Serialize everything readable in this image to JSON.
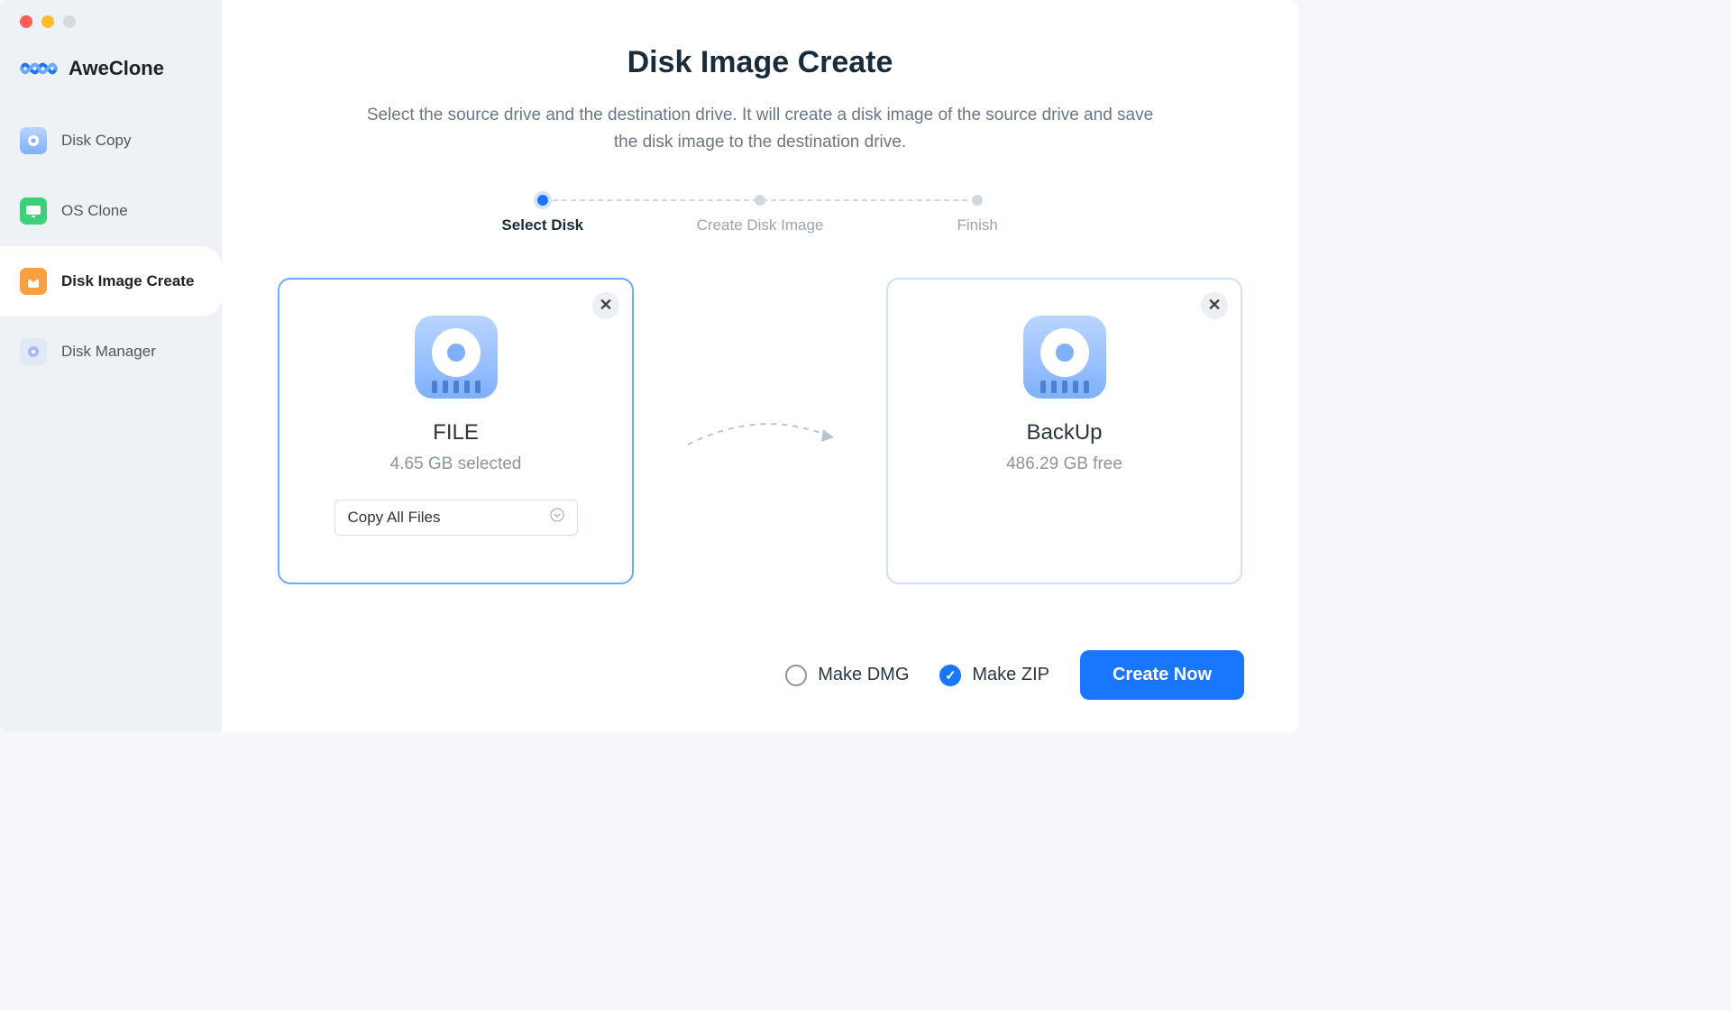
{
  "app": {
    "name": "AweClone"
  },
  "sidebar": {
    "items": [
      {
        "label": "Disk Copy"
      },
      {
        "label": "OS Clone"
      },
      {
        "label": "Disk Image Create"
      },
      {
        "label": "Disk Manager"
      }
    ]
  },
  "page": {
    "title": "Disk Image Create",
    "subtitle": "Select the source drive and the destination drive. It will create a disk image of the source drive and save the disk image to the destination drive."
  },
  "stepper": {
    "steps": [
      {
        "label": "Select Disk"
      },
      {
        "label": "Create Disk Image"
      },
      {
        "label": "Finish"
      }
    ]
  },
  "source": {
    "name": "FILE",
    "detail": "4.65 GB selected",
    "mode": "Copy All Files"
  },
  "destination": {
    "name": "BackUp",
    "detail": "486.29 GB free"
  },
  "options": {
    "dmg_label": "Make DMG",
    "zip_label": "Make ZIP"
  },
  "action": {
    "primary": "Create Now"
  }
}
